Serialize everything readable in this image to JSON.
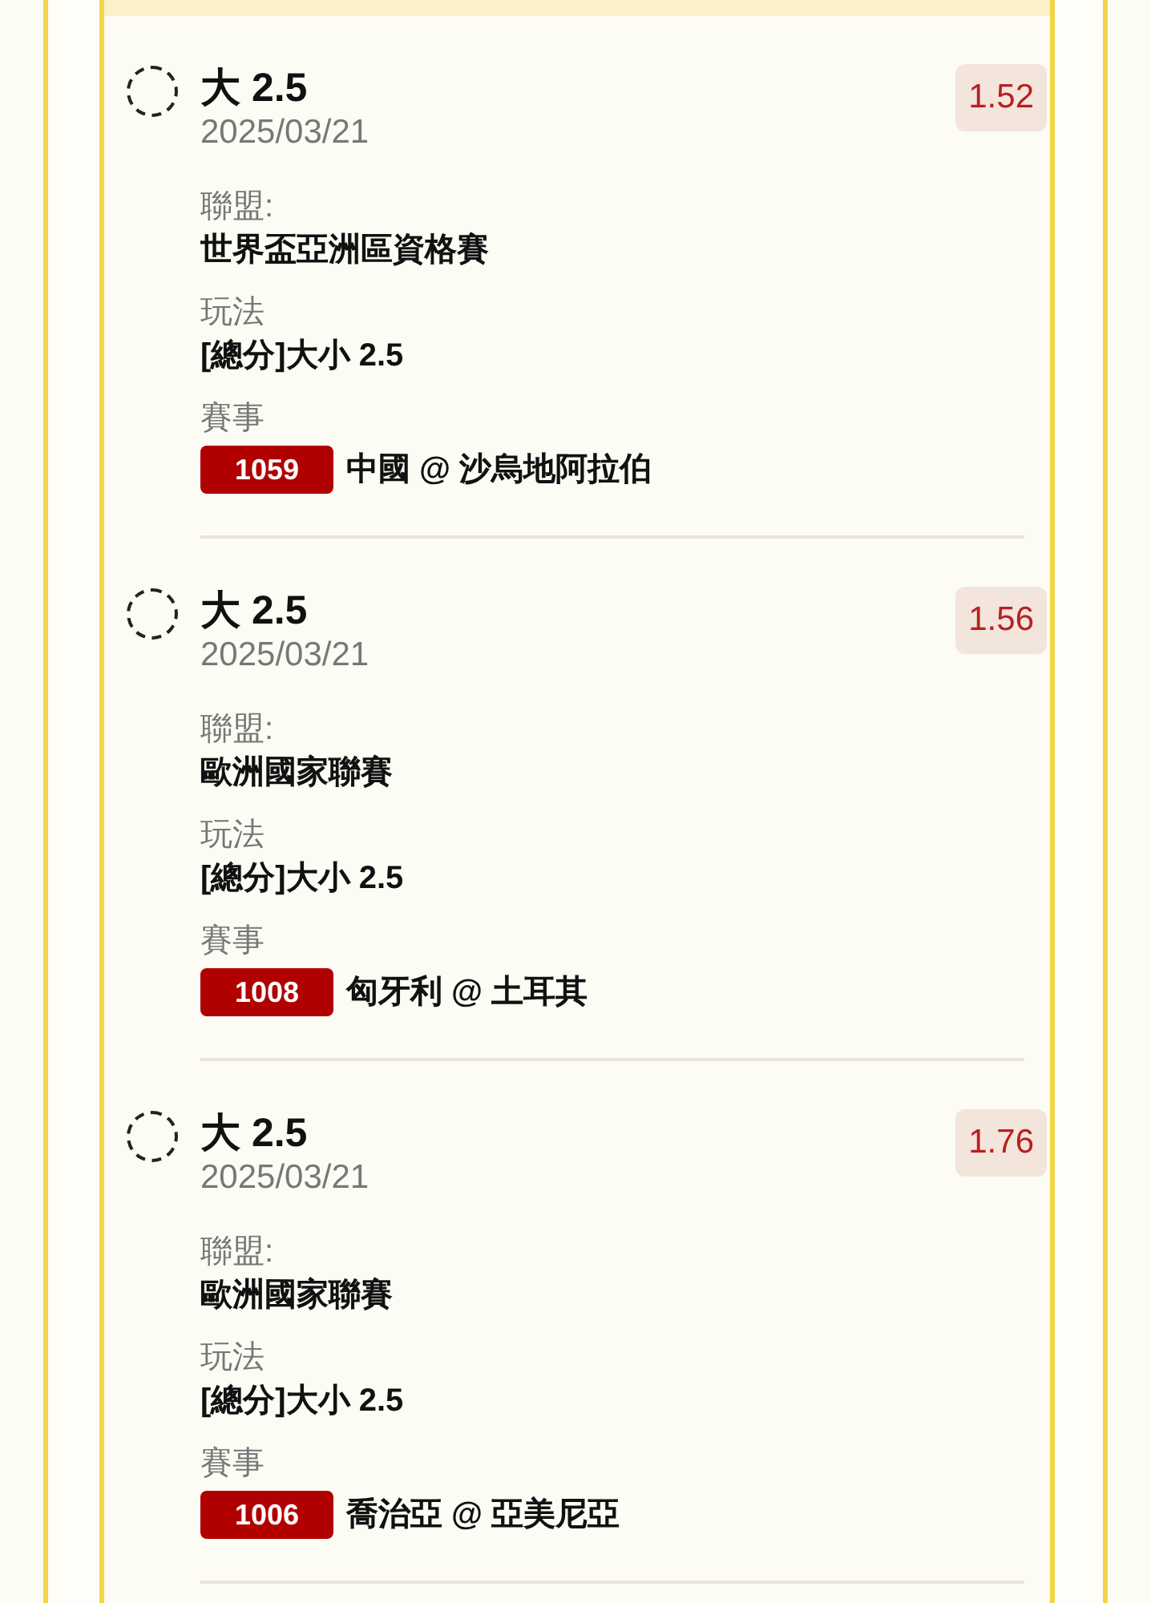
{
  "bets": [
    {
      "selected": false,
      "selection": "大 2.5",
      "date": "2025/03/21",
      "odds": "1.52",
      "league_label": "聯盟:",
      "league": "世界盃亞洲區資格賽",
      "market_label": "玩法",
      "market": "[總分]大小 2.5",
      "match_label": "賽事",
      "match_no": "1059",
      "match": "中國 @ 沙烏地阿拉伯"
    },
    {
      "selected": false,
      "selection": "大 2.5",
      "date": "2025/03/21",
      "odds": "1.56",
      "league_label": "聯盟:",
      "league": "歐洲國家聯賽",
      "market_label": "玩法",
      "market": "[總分]大小 2.5",
      "match_label": "賽事",
      "match_no": "1008",
      "match": "匈牙利 @ 土耳其"
    },
    {
      "selected": false,
      "selection": "大 2.5",
      "date": "2025/03/21",
      "odds": "1.76",
      "league_label": "聯盟:",
      "league": "歐洲國家聯賽",
      "market_label": "玩法",
      "market": "[總分]大小 2.5",
      "match_label": "賽事",
      "match_no": "1006",
      "match": "喬治亞 @ 亞美尼亞"
    }
  ]
}
